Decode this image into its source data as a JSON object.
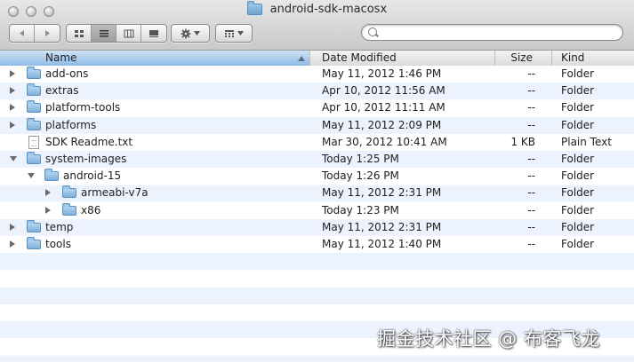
{
  "window": {
    "title": "android-sdk-macosx"
  },
  "toolbar": {
    "back_icon": "back-arrow-icon",
    "forward_icon": "forward-arrow-icon",
    "views": [
      "icon-view",
      "list-view",
      "column-view",
      "cover-flow-view"
    ],
    "active_view": "list-view",
    "action_icon": "gear-icon",
    "arrange_icon": "arrange-grid-icon",
    "search_placeholder": ""
  },
  "columns": {
    "name": "Name",
    "date": "Date Modified",
    "size": "Size",
    "kind": "Kind",
    "sorted_by": "Name"
  },
  "rows": [
    {
      "name": "add-ons",
      "date": "May 11, 2012 1:46 PM",
      "size": "--",
      "kind": "Folder",
      "type": "folder",
      "depth": 0,
      "disclosure": "closed"
    },
    {
      "name": "extras",
      "date": "Apr 10, 2012 11:56 AM",
      "size": "--",
      "kind": "Folder",
      "type": "folder",
      "depth": 0,
      "disclosure": "closed"
    },
    {
      "name": "platform-tools",
      "date": "Apr 10, 2012 11:11 AM",
      "size": "--",
      "kind": "Folder",
      "type": "folder",
      "depth": 0,
      "disclosure": "closed"
    },
    {
      "name": "platforms",
      "date": "May 11, 2012 2:09 PM",
      "size": "--",
      "kind": "Folder",
      "type": "folder",
      "depth": 0,
      "disclosure": "closed"
    },
    {
      "name": "SDK Readme.txt",
      "date": "Mar 30, 2012 10:41 AM",
      "size": "1 KB",
      "kind": "Plain Text",
      "type": "file",
      "depth": 0,
      "disclosure": "none"
    },
    {
      "name": "system-images",
      "date": "Today 1:25 PM",
      "size": "--",
      "kind": "Folder",
      "type": "folder",
      "depth": 0,
      "disclosure": "open"
    },
    {
      "name": "android-15",
      "date": "Today 1:26 PM",
      "size": "--",
      "kind": "Folder",
      "type": "folder",
      "depth": 1,
      "disclosure": "open"
    },
    {
      "name": "armeabi-v7a",
      "date": "May 11, 2012 2:31 PM",
      "size": "--",
      "kind": "Folder",
      "type": "folder",
      "depth": 2,
      "disclosure": "closed"
    },
    {
      "name": "x86",
      "date": "Today 1:23 PM",
      "size": "--",
      "kind": "Folder",
      "type": "folder",
      "depth": 2,
      "disclosure": "closed"
    },
    {
      "name": "temp",
      "date": "May 11, 2012 2:31 PM",
      "size": "--",
      "kind": "Folder",
      "type": "folder",
      "depth": 0,
      "disclosure": "closed"
    },
    {
      "name": "tools",
      "date": "May 11, 2012 1:40 PM",
      "size": "--",
      "kind": "Folder",
      "type": "folder",
      "depth": 0,
      "disclosure": "closed"
    }
  ],
  "watermark": "掘金技术社区 @ 布客飞龙"
}
